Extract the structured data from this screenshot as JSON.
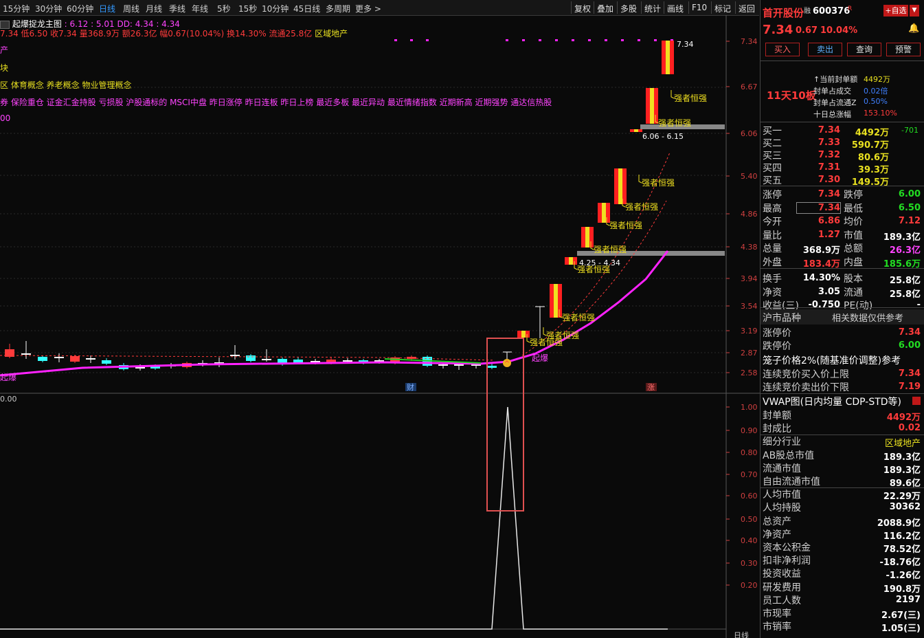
{
  "toolbar": {
    "periods": [
      "15分钟",
      "30分钟",
      "60分钟",
      "日线",
      "周线",
      "月线",
      "季线",
      "年线",
      "5秒",
      "15秒",
      "10分钟",
      "45日线",
      "多周期",
      "更多 >"
    ],
    "active_period": "日线",
    "tools": [
      "复权",
      "叠加",
      "多股",
      "统计",
      "画线",
      "F10",
      "标记",
      "返回"
    ]
  },
  "chart": {
    "indicator_title": "起爆捉龙主图",
    "indicator_vals": ": 6.12 : 5.01  DD: 4.34 : 4.34",
    "ohlc_line": "7.34 低6.50 收7.34 量368.9万 额26.3亿 幅0.67(10.04%) 换14.30% 流通25.8亿",
    "region": "区域地产",
    "concept_1": "产",
    "concept_2": "块",
    "concept_3": "区 体育概念 养老概念 物业管理概念",
    "concept_4": "券 保险重仓 证金汇金持股 亏损股 沪股通标的 MSCI中盘 昨日涨停 昨日连板 昨日上榜 最近多板 最近异动 最近情绪指数 近期新高 近期强势 通达信热股",
    "concept_5": "00",
    "label_start": "起爆",
    "label_fin": "财",
    "label_zhang": "涨",
    "label_lower_zero": "0.00",
    "strong_label": "强者恒强",
    "start_label": "起爆",
    "range1": "4.25 - 4.34",
    "range2": "6.06 - 6.15",
    "top_price": "7.34",
    "axis_main": [
      "7.34",
      "6.67",
      "6.06",
      "5.40",
      "4.86",
      "4.38",
      "3.94",
      "3.54",
      "3.19",
      "2.87",
      "2.58"
    ],
    "axis_lower": [
      "1.00",
      "0.90",
      "0.80",
      "0.70",
      "0.60",
      "0.50",
      "0.40",
      "0.30",
      "0.20"
    ],
    "axis_bottom_label": "日线"
  },
  "stock": {
    "name": "首开股份",
    "tag": "融",
    "code": "600376",
    "code_mark": "R",
    "add_fav": "+自选",
    "price": "7.34",
    "change": "0.67",
    "pct": "10.04%",
    "buttons": [
      "买入",
      "卖出",
      "查询",
      "预警"
    ],
    "board_streak": "11天10板",
    "seal_info": [
      {
        "label": "↑当前封单额",
        "value": "4492万"
      },
      {
        "label": "封单占成交",
        "value": "0.02倍"
      },
      {
        "label": "封单占流通Z",
        "value": "0.50%"
      },
      {
        "label": "十日总涨幅",
        "value": "153.10%"
      }
    ],
    "bids": [
      {
        "label": "买一",
        "price": "7.34",
        "vol": "4492万",
        "chg": "-701"
      },
      {
        "label": "买二",
        "price": "7.33",
        "vol": "590.7万",
        "chg": ""
      },
      {
        "label": "买三",
        "price": "7.32",
        "vol": "80.6万",
        "chg": ""
      },
      {
        "label": "买四",
        "price": "7.31",
        "vol": "39.3万",
        "chg": ""
      },
      {
        "label": "买五",
        "price": "7.30",
        "vol": "149.5万",
        "chg": ""
      }
    ],
    "stats": [
      {
        "l1": "涨停",
        "v1": "7.34",
        "l2": "跌停",
        "v2": "6.00"
      },
      {
        "l1": "最高",
        "v1": "7.34",
        "l2": "最低",
        "v2": "6.50"
      },
      {
        "l1": "今开",
        "v1": "6.86",
        "l2": "均价",
        "v2": "7.12"
      },
      {
        "l1": "量比",
        "v1": "1.27",
        "l2": "市值",
        "v2": "189.3亿"
      },
      {
        "l1": "总量",
        "v1": "368.9万",
        "l2": "总额",
        "v2": "26.3亿"
      },
      {
        "l1": "外盘",
        "v1": "183.4万",
        "l2": "内盘",
        "v2": "185.6万"
      },
      {
        "l1": "换手",
        "v1": "14.30%",
        "l2": "股本",
        "v2": "25.8亿"
      },
      {
        "l1": "净资",
        "v1": "3.05",
        "l2": "流通",
        "v2": "25.8亿"
      },
      {
        "l1": "收益(三)",
        "v1": "-0.750",
        "l2": "PE(动)",
        "v2": "-"
      }
    ],
    "market_title": "沪市品种",
    "market_note": "相关数据仅供参考",
    "limit_up_label": "涨停价",
    "limit_up": "7.34",
    "limit_down_label": "跌停价",
    "limit_down": "6.00",
    "cage_label": "笼子价格2%(随基准价调整)参考",
    "cont_buy_label": "连续竞价买入价上限",
    "cont_buy": "7.34",
    "cont_sell_label": "连续竞价卖出价下限",
    "cont_sell": "7.19",
    "vwap_label": "VWAP图(日内均量 CDP-STD等)",
    "fund": [
      {
        "l": "封单额",
        "v": "4492万"
      },
      {
        "l": "封成比",
        "v": "0.02"
      },
      {
        "l": "细分行业",
        "v": "区域地产"
      },
      {
        "l": "AB股总市值",
        "v": "189.3亿"
      },
      {
        "l": "流通市值",
        "v": "189.3亿"
      },
      {
        "l": "自由流通市值",
        "v": "89.6亿"
      },
      {
        "l": "人均市值",
        "v": "22.29万"
      },
      {
        "l": "人均持股",
        "v": "30362"
      },
      {
        "l": "总资产",
        "v": "2088.9亿"
      },
      {
        "l": "净资产",
        "v": "116.2亿"
      },
      {
        "l": "资本公积金",
        "v": "78.52亿"
      },
      {
        "l": "扣非净利润",
        "v": "-18.76亿"
      },
      {
        "l": "投资收益",
        "v": "-1.26亿"
      },
      {
        "l": "研发费用",
        "v": "190.8万"
      },
      {
        "l": "员工人数",
        "v": "2197"
      },
      {
        "l": "市现率",
        "v": "2.67(三)"
      },
      {
        "l": "市销率",
        "v": "1.05(三)"
      }
    ]
  }
}
